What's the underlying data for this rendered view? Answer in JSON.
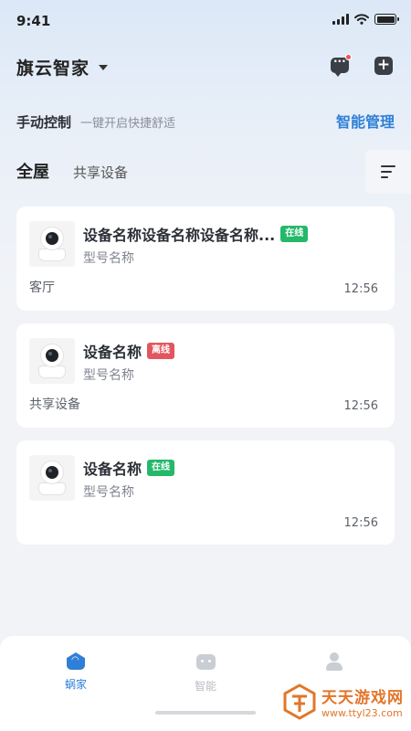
{
  "status_bar": {
    "time": "9:41"
  },
  "header": {
    "home_title": "旗云智家"
  },
  "control": {
    "title": "手动控制",
    "subtitle": "一键开启快捷舒适",
    "smart_link": "智能管理"
  },
  "tabs": [
    {
      "label": "全屋",
      "active": true
    },
    {
      "label": "共享设备",
      "active": false
    }
  ],
  "devices": [
    {
      "name": "设备名称设备名称设备名称...",
      "status": "在线",
      "status_color": "#25b86b",
      "model": "型号名称",
      "room": "客厅",
      "time": "12:56"
    },
    {
      "name": "设备名称",
      "status": "离线",
      "status_color": "#e3565f",
      "model": "型号名称",
      "room": "共享设备",
      "time": "12:56"
    },
    {
      "name": "设备名称",
      "status": "在线",
      "status_color": "#25b86b",
      "model": "型号名称",
      "room": "",
      "time": "12:56"
    }
  ],
  "tabbar": [
    {
      "label": "蜗家",
      "icon": "home-wifi-icon",
      "active": true,
      "color": "#2f7fd8"
    },
    {
      "label": "智能",
      "icon": "robot-icon",
      "active": false,
      "color": "#b8bcc4"
    },
    {
      "label": "",
      "icon": "user-icon",
      "active": false,
      "color": "#b8bcc4"
    }
  ],
  "watermark": {
    "name": "天天游戏网",
    "url": "www.ttyl23.com"
  },
  "colors": {
    "accent": "#2f7fd8",
    "online": "#25b86b",
    "offline": "#e3565f",
    "watermark": "#e2762a"
  }
}
